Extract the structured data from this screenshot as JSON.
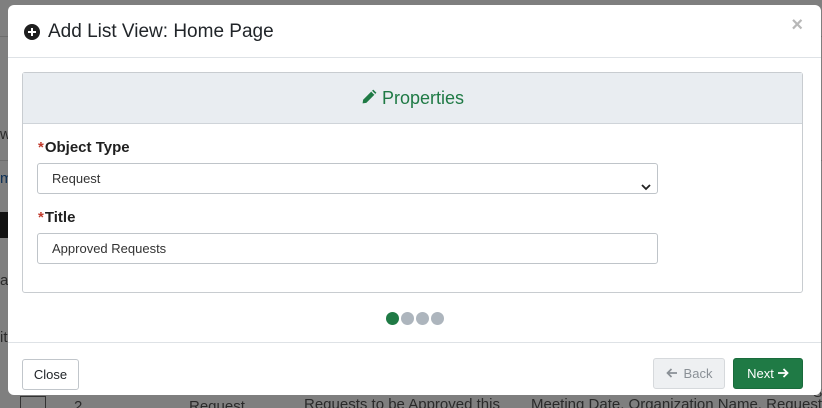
{
  "modal": {
    "title": "Add List View: Home Page",
    "close_symbol": "×",
    "title_icon": "plus-circle-icon"
  },
  "card": {
    "title": "Properties",
    "title_icon": "pencil-icon",
    "accent_color": "#1f7a45"
  },
  "form": {
    "object_type": {
      "required_mark": "*",
      "label": "Object Type",
      "value": "Request"
    },
    "title": {
      "required_mark": "*",
      "label": "Title",
      "value": "Approved Requests"
    }
  },
  "wizard": {
    "steps": 4,
    "current_step": 1
  },
  "footer": {
    "close_label": "Close",
    "back_label": "Back",
    "next_label": "Next"
  },
  "background": {
    "fragments": [
      "w",
      "m",
      "lo",
      "ar",
      "it",
      "2",
      "Request",
      "Requests to be Approved this",
      "Meeting Date, Organization Name, Request",
      "o"
    ]
  }
}
